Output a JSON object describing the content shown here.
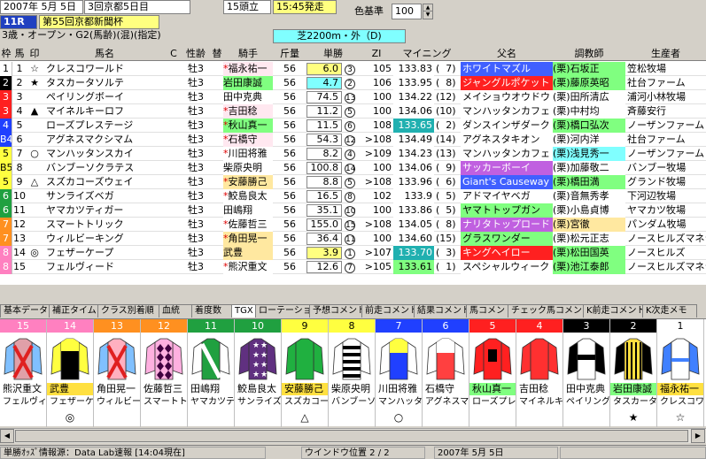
{
  "header": {
    "date": "2007年  5月  5日",
    "venue": "3回京都5日目",
    "runners": "15頭立",
    "start": "15:45発走",
    "race_no": "11R",
    "race_name": "第55回京都新聞杯",
    "conditions": "3歳・オープン・G2(馬齢)(混)(指定)",
    "course": "芝2200m・外（D)",
    "color_std_label": "色基準",
    "color_std_value": "100"
  },
  "columns": [
    "枠",
    "馬",
    "印",
    "馬名",
    "C",
    "性齢",
    "替",
    "騎手",
    "斤量",
    "単勝",
    "ZI",
    "マイニング",
    "父名",
    "調教師",
    "生産者"
  ],
  "rows": [
    {
      "gate": "1",
      "gate_bg": "#ffffff",
      "gate_fg": "#000",
      "num": "1",
      "mark": "☆",
      "name": "クレスコワールド",
      "sex": "牡3",
      "chg": "",
      "jockey": "福永祐一",
      "jbg": "#ffe8f0",
      "jstar": true,
      "weight": "56",
      "odds": "6.0",
      "obg": "#ffff80",
      "pop": "3",
      "zi": "105",
      "mining": "133.83",
      "mrank": "7",
      "mbg": "#ffffff",
      "sire": "ホワイトマズル",
      "sbg": "#4060ff",
      "sfg": "#fff",
      "trainer": "(栗)石坂正",
      "tbg": "#80ff80",
      "breeder": "笠松牧場"
    },
    {
      "gate": "2",
      "gate_bg": "#000000",
      "gate_fg": "#fff",
      "num": "2",
      "mark": "★",
      "name": "タスカータソルテ",
      "sex": "牡3",
      "chg": "",
      "jockey": "岩田康誠",
      "jbg": "#80ff80",
      "jstar": false,
      "weight": "56",
      "odds": "4.7",
      "obg": "#80ffff",
      "pop": "2",
      "zi": "106",
      "mining": "133.95",
      "mrank": "8",
      "mbg": "#ffffff",
      "sire": "ジャングルポケット",
      "sbg": "#ff2020",
      "sfg": "#fff",
      "trainer": "(栗)藤原英昭",
      "tbg": "#80ff80",
      "breeder": "社台ファーム"
    },
    {
      "gate": "3",
      "gate_bg": "#ff2020",
      "gate_fg": "#fff",
      "num": "3",
      "mark": "",
      "name": "ペイリングボーイ",
      "sex": "牡3",
      "chg": "",
      "jockey": "田中克典",
      "jbg": "#ffffff",
      "jstar": false,
      "weight": "56",
      "odds": "74.5",
      "obg": "#ffffff",
      "pop": "13",
      "zi": "100",
      "mining": "134.22",
      "mrank": "12",
      "mbg": "#ffffff",
      "sire": "メイショウオウドウ",
      "sbg": "#ffffff",
      "sfg": "#000",
      "trainer": "(栗)田所清広",
      "tbg": "#ffffff",
      "breeder": "浦河小林牧場"
    },
    {
      "gate": "3",
      "gate_bg": "#ff2020",
      "gate_fg": "#fff",
      "num": "4",
      "mark": "▲",
      "name": "マイネルキーロフ",
      "sex": "牡3",
      "chg": "",
      "jockey": "吉田稔",
      "jbg": "#ffe8f0",
      "jstar": true,
      "weight": "56",
      "odds": "11.2",
      "obg": "#ffffff",
      "pop": "5",
      "zi": "100",
      "mining": "134.06",
      "mrank": "10",
      "mbg": "#ffffff",
      "sire": "マンハッタンカフェ",
      "sbg": "#ffffff",
      "sfg": "#000",
      "trainer": "(栗)中村均",
      "tbg": "#ffffff",
      "breeder": "斉藤安行"
    },
    {
      "gate": "4",
      "gate_bg": "#2040ff",
      "gate_fg": "#fff",
      "num": "5",
      "mark": "",
      "name": "ローズプレステージ",
      "sex": "牡3",
      "chg": "",
      "jockey": "秋山真一",
      "jbg": "#80ff80",
      "jstar": true,
      "weight": "56",
      "odds": "11.5",
      "obg": "#ffffff",
      "pop": "6",
      "zi": "108",
      "mining": "133.65",
      "mrank": "2",
      "mbg": "#20b0b0",
      "sire": "ダンスインザダーク",
      "sbg": "#ffffff",
      "sfg": "#000",
      "trainer": "(栗)橋口弘次",
      "tbg": "#80ff80",
      "breeder": "ノーザンファーム"
    },
    {
      "gate": "B4",
      "gate_bg": "#2040ff",
      "gate_fg": "#fff",
      "num": "6",
      "mark": "",
      "name": "アグネスマクシマム",
      "sex": "牡3",
      "chg": "",
      "jockey": "石橋守",
      "jbg": "#ffe8f0",
      "jstar": true,
      "weight": "56",
      "odds": "54.3",
      "obg": "#ffffff",
      "pop": "12",
      "zi": ">108",
      "mining": "134.49",
      "mrank": "14",
      "mbg": "#ffffff",
      "sire": "アグネスタキオン",
      "sbg": "#ffffff",
      "sfg": "#000",
      "trainer": "(栗)河内洋",
      "tbg": "#ffffff",
      "breeder": "社台ファーム"
    },
    {
      "gate": "5",
      "gate_bg": "#ffff40",
      "gate_fg": "#000",
      "num": "7",
      "mark": "○",
      "name": "マンハッタンスカイ",
      "sex": "牡3",
      "chg": "",
      "jockey": "川田将雅",
      "jbg": "#ffffff",
      "jstar": true,
      "weight": "56",
      "odds": "8.2",
      "obg": "#ffffff",
      "pop": "4",
      "zi": ">109",
      "mining": "134.23",
      "mrank": "13",
      "mbg": "#ffffff",
      "sire": "マンハッタンカフェ",
      "sbg": "#ffffff",
      "sfg": "#000",
      "trainer": "(栗)浅見秀一",
      "tbg": "#80ffff",
      "breeder": "ノーザンファーム"
    },
    {
      "gate": "B5",
      "gate_bg": "#ffff40",
      "gate_fg": "#000",
      "num": "8",
      "mark": "",
      "name": "バンブーソクラテス",
      "sex": "牡3",
      "chg": "",
      "jockey": "柴原央明",
      "jbg": "#ffffff",
      "jstar": false,
      "weight": "56",
      "odds": "100.8",
      "obg": "#ffffff",
      "pop": "14",
      "zi": "100",
      "mining": "134.06",
      "mrank": "9",
      "mbg": "#ffffff",
      "sire": "サッカーボーイ",
      "sbg": "#c060e0",
      "sfg": "#fff",
      "trainer": "(栗)加藤敬二",
      "tbg": "#ffffff",
      "breeder": "バンブー牧場"
    },
    {
      "gate": "5",
      "gate_bg": "#ffff40",
      "gate_fg": "#000",
      "num": "9",
      "mark": "△",
      "name": "スズカコーズウェイ",
      "sex": "牡3",
      "chg": "",
      "jockey": "安藤勝己",
      "jbg": "#ffe8a0",
      "jstar": true,
      "weight": "56",
      "odds": "8.8",
      "obg": "#ffffff",
      "pop": "5",
      "zi": ">108",
      "mining": "133.96",
      "mrank": "6",
      "mbg": "#ffffff",
      "sire": "Giant's Causeway",
      "sbg": "#4060ff",
      "sfg": "#fff",
      "trainer": "(栗)橋田満",
      "tbg": "#80ff80",
      "breeder": "グランド牧場"
    },
    {
      "gate": "6",
      "gate_bg": "#20a040",
      "gate_fg": "#fff",
      "num": "10",
      "mark": "",
      "name": "サンライズベガ",
      "sex": "牡3",
      "chg": "",
      "jockey": "鮫島良太",
      "jbg": "#ffffff",
      "jstar": true,
      "weight": "56",
      "odds": "16.5",
      "obg": "#ffffff",
      "pop": "8",
      "zi": "102",
      "mining": "133.9",
      "mrank": "5",
      "mbg": "#ffffff",
      "sire": "アドマイヤベガ",
      "sbg": "#ffffff",
      "sfg": "#000",
      "trainer": "(栗)音無秀孝",
      "tbg": "#ffffff",
      "breeder": "下河辺牧場"
    },
    {
      "gate": "6",
      "gate_bg": "#20a040",
      "gate_fg": "#fff",
      "num": "11",
      "mark": "",
      "name": "ヤマカツティガー",
      "sex": "牡3",
      "chg": "",
      "jockey": "田嶋翔",
      "jbg": "#ffffff",
      "jstar": false,
      "weight": "56",
      "odds": "35.1",
      "obg": "#ffffff",
      "pop": "10",
      "zi": "100",
      "mining": "133.86",
      "mrank": "5",
      "mbg": "#ffffff",
      "sire": "ヤマトトップガン",
      "sbg": "#80ff80",
      "sfg": "#000",
      "trainer": "(栗)小島貞博",
      "tbg": "#ffffff",
      "breeder": "ヤマカツ牧場"
    },
    {
      "gate": "7",
      "gate_bg": "#ff9020",
      "gate_fg": "#fff",
      "num": "12",
      "mark": "",
      "name": "スマートトリック",
      "sex": "牡3",
      "chg": "",
      "jockey": "佐藤哲三",
      "jbg": "#ffffff",
      "jstar": true,
      "weight": "56",
      "odds": "155.0",
      "obg": "#ffffff",
      "pop": "15",
      "zi": ">108",
      "mining": "134.05",
      "mrank": "8",
      "mbg": "#ffffff",
      "sire": "ナリタトップロード",
      "sbg": "#c060e0",
      "sfg": "#fff",
      "trainer": "(栗)宮徹",
      "tbg": "#ffe8a0",
      "breeder": "パンダム牧場"
    },
    {
      "gate": "7",
      "gate_bg": "#ff9020",
      "gate_fg": "#fff",
      "num": "13",
      "mark": "",
      "name": "ウィルビーキング",
      "sex": "牡3",
      "chg": "",
      "jockey": "角田晃一",
      "jbg": "#ffe8a0",
      "jstar": true,
      "weight": "56",
      "odds": "36.4",
      "obg": "#ffffff",
      "pop": "11",
      "zi": "100",
      "mining": "134.60",
      "mrank": "15",
      "mbg": "#ffffff",
      "sire": "グラスワンダー",
      "sbg": "#80ff80",
      "sfg": "#000",
      "trainer": "(栗)松元正志",
      "tbg": "#ffffff",
      "breeder": "ノースヒルズマネジ"
    },
    {
      "gate": "8",
      "gate_bg": "#ff80c0",
      "gate_fg": "#fff",
      "num": "14",
      "mark": "◎",
      "name": "フェザーケープ",
      "sex": "牡3",
      "chg": "",
      "jockey": "武豊",
      "jbg": "#ffe8a0",
      "jstar": false,
      "weight": "56",
      "odds": "3.9",
      "obg": "#ffff80",
      "pop": "1",
      "zi": ">107",
      "mining": "133.70",
      "mrank": "3",
      "mbg": "#20b0b0",
      "sire": "キングヘイロー",
      "sbg": "#ff2020",
      "sfg": "#fff",
      "trainer": "(栗)松田国英",
      "tbg": "#80ff80",
      "breeder": "ノースヒルズ"
    },
    {
      "gate": "8",
      "gate_bg": "#ff80c0",
      "gate_fg": "#fff",
      "num": "15",
      "mark": "",
      "name": "フェルヴィード",
      "sex": "牡3",
      "chg": "",
      "jockey": "熊沢重文",
      "jbg": "#ffffff",
      "jstar": true,
      "weight": "56",
      "odds": "12.6",
      "obg": "#ffffff",
      "pop": "7",
      "zi": ">105",
      "mining": "133.61",
      "mrank": "1",
      "mbg": "#80ff80",
      "sire": "スペシャルウィーク",
      "sbg": "#ffffff",
      "sfg": "#000",
      "trainer": "(栗)池江泰郎",
      "tbg": "#80ff80",
      "breeder": "ノースヒルズマネジ"
    }
  ],
  "tabs": [
    "基本データ",
    "補正タイム",
    "クラス別着順",
    "血統",
    "着度数",
    "TGX",
    "ローテーション",
    "予想コメント",
    "前走コメント",
    "結果コメント",
    "馬コメント",
    "チェック馬コメント",
    "K前走コメント",
    "K次走メモ"
  ],
  "silks": [
    {
      "num": "15",
      "numbg": "#ff80c0",
      "jockey": "熊沢重文",
      "jbg": "#ffffff",
      "horse": "フェルヴィード",
      "mark": "",
      "body": "#e0a0a8",
      "sleeve": "#80c0ff",
      "pattern": "cross"
    },
    {
      "num": "14",
      "numbg": "#ff80c0",
      "jockey": "武豊",
      "jbg": "#ffe040",
      "horse": "フェザーケープ",
      "mark": "◎",
      "body": "#000000",
      "sleeve": "#ffff40",
      "pattern": "yoke"
    },
    {
      "num": "13",
      "numbg": "#ff9020",
      "jockey": "角田晃一",
      "jbg": "#ffffff",
      "horse": "ウィルビーキング",
      "mark": "",
      "body": "#ffb0c0",
      "sleeve": "#80c0ff",
      "pattern": "cross"
    },
    {
      "num": "12",
      "numbg": "#ff9020",
      "jockey": "佐藤哲三",
      "jbg": "#ffffff",
      "horse": "スマートトリック",
      "mark": "",
      "body": "#ffb0e0",
      "sleeve": "#ffb0e0",
      "pattern": "diamond"
    },
    {
      "num": "11",
      "numbg": "#20a040",
      "jockey": "田嶋翔",
      "jbg": "#ffffff",
      "horse": "ヤマカツティガー",
      "mark": "",
      "body": "#20a040",
      "sleeve": "#ffffff",
      "pattern": "sash"
    },
    {
      "num": "10",
      "numbg": "#20a040",
      "jockey": "鮫島良太",
      "jbg": "#ffffff",
      "horse": "サンライズベガ",
      "mark": "",
      "body": "#603080",
      "sleeve": "#603080",
      "pattern": "stars"
    },
    {
      "num": "9",
      "numbg": "#ffff40",
      "jockey": "安藤勝己",
      "jbg": "#ffe040",
      "horse": "スズカコーズウェイ",
      "mark": "△",
      "body": "#20b040",
      "sleeve": "#20b040",
      "pattern": "plain"
    },
    {
      "num": "8",
      "numbg": "#ffff40",
      "jockey": "柴原央明",
      "jbg": "#ffffff",
      "horse": "バンブーソクラテス",
      "mark": "",
      "body": "#ffffff",
      "sleeve": "#ffffff",
      "pattern": "hoops"
    },
    {
      "num": "7",
      "numbg": "#2040ff",
      "jockey": "川田将雅",
      "jbg": "#ffffff",
      "horse": "マンハッタンスカイ",
      "mark": "○",
      "body": "#2040ff",
      "sleeve": "#ffffff",
      "pattern": "yoke2"
    },
    {
      "num": "6",
      "numbg": "#2040ff",
      "jockey": "石橋守",
      "jbg": "#ffffff",
      "horse": "アグネスマクシマム",
      "mark": "",
      "body": "#ff4040",
      "sleeve": "#ffffff",
      "pattern": "yoke3"
    },
    {
      "num": "5",
      "numbg": "#ff2020",
      "jockey": "秋山真一",
      "jbg": "#80ff80",
      "horse": "ローズプレステージ",
      "mark": "",
      "body": "#ff2020",
      "sleeve": "#ff2020",
      "pattern": "shield"
    },
    {
      "num": "4",
      "numbg": "#ff2020",
      "jockey": "吉田稔",
      "jbg": "#ffffff",
      "horse": "マイネルキーロフ",
      "mark": "",
      "body": "#ff3030",
      "sleeve": "#ff3030",
      "pattern": "plain"
    },
    {
      "num": "3",
      "numbg": "#000000",
      "jockey": "田中克典",
      "jbg": "#ffffff",
      "horse": "ペイリングボーイ",
      "mark": "",
      "body": "#ffffff",
      "sleeve": "#000000",
      "pattern": "sleeves"
    },
    {
      "num": "2",
      "numbg": "#000000",
      "jockey": "岩田康誠",
      "jbg": "#80ff80",
      "horse": "タスカータソルテ",
      "mark": "★",
      "body": "#ffe040",
      "sleeve": "#000000",
      "pattern": "stripes"
    },
    {
      "num": "1",
      "numbg": "#ffffff",
      "jockey": "福永祐一",
      "jbg": "#ffe040",
      "horse": "クレスコワールド",
      "mark": "☆",
      "body": "#ffffff",
      "sleeve": "#4080ff",
      "pattern": "plain2"
    }
  ],
  "status": {
    "source": "単勝ｵｯｽﾞ情報源：Data Lab速報 [14:04現在]",
    "window": "ウインドウ位置  2 / 2",
    "date": "2007年  5月  5日"
  }
}
